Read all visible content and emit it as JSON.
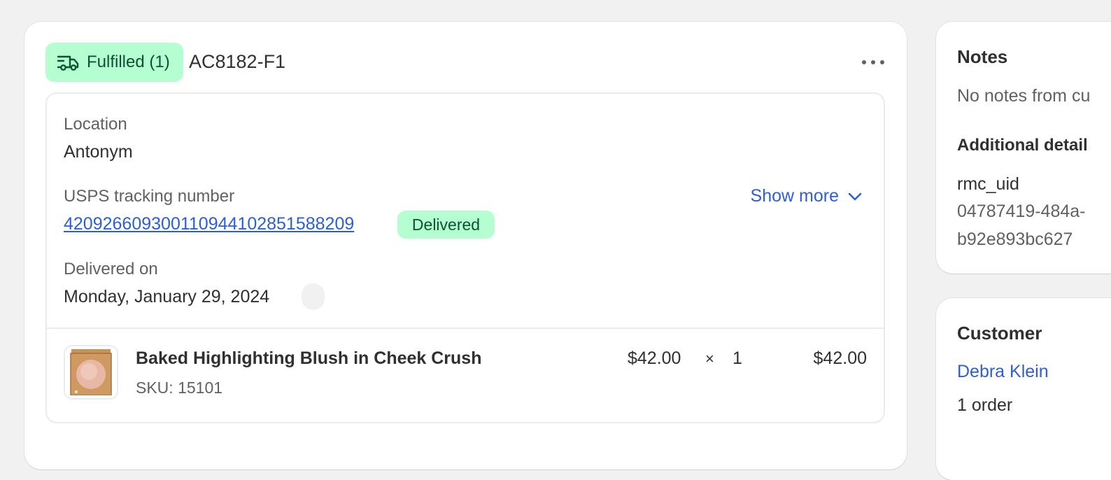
{
  "fulfillment": {
    "status_label": "Fulfilled (1)",
    "id": "AC8182-F1",
    "location_label": "Location",
    "location_value": "Antonym",
    "tracking_label": "USPS tracking number",
    "tracking_number": "420926609300110944102851588209",
    "tracking_status": "Delivered",
    "show_more_label": "Show more",
    "delivered_on_label": "Delivered on",
    "delivered_on_value": "Monday, January 29, 2024",
    "line_item": {
      "name": "Baked Highlighting Blush in Cheek Crush",
      "sku": "SKU: 15101",
      "unit_price": "$42.00",
      "times": "×",
      "quantity": "1",
      "total": "$42.00"
    }
  },
  "notes": {
    "title": "Notes",
    "text": "No notes from cu",
    "additional_title": "Additional detail",
    "attr_key": "rmc_uid",
    "attr_value_line1": "04787419-484a-",
    "attr_value_line2": "b92e893bc627"
  },
  "customer": {
    "title": "Customer",
    "name": "Debra Klein",
    "orders": "1 order"
  },
  "colors": {
    "success_bg": "#b4fed2",
    "success_text": "#0c5132",
    "link": "#2c5fd6",
    "page_bg": "#f1f1f1"
  },
  "icons": {
    "status": "delivery-truck-icon",
    "menu": "more-horizontal-icon",
    "show_more": "chevron-down-icon"
  }
}
